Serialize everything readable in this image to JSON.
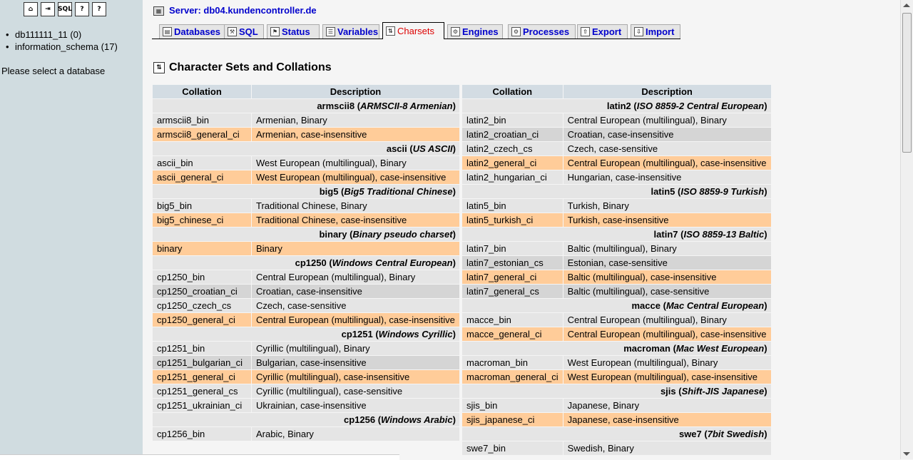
{
  "nav": {
    "icons": [
      {
        "name": "home-icon",
        "glyph": "⌂"
      },
      {
        "name": "exit-icon",
        "glyph": "⇥"
      },
      {
        "name": "sql-query-icon",
        "glyph": "SQL"
      },
      {
        "name": "documentation-icon",
        "glyph": "?"
      },
      {
        "name": "sql-docs-icon",
        "glyph": "?"
      }
    ],
    "databases": [
      "db111111_11 (0)",
      "information_schema (17)"
    ],
    "message": "Please select a database"
  },
  "header": {
    "server_label": "Server: db04.kundencontroller.de"
  },
  "tabs": [
    {
      "label": "Databases",
      "icon": "database-icon"
    },
    {
      "label": "SQL",
      "icon": "sql-icon"
    },
    {
      "label": "Status",
      "icon": "status-icon"
    },
    {
      "label": "Variables",
      "icon": "variables-icon"
    },
    {
      "label": "Charsets",
      "icon": "charsets-icon",
      "active": true
    },
    {
      "label": "Engines",
      "icon": "engines-icon"
    },
    {
      "label": "Processes",
      "icon": "processes-icon"
    },
    {
      "label": "Export",
      "icon": "export-icon"
    },
    {
      "label": "Import",
      "icon": "import-icon"
    }
  ],
  "page_title": "Character Sets and Collations",
  "table_headers": {
    "collation": "Collation",
    "description": "Description"
  },
  "charsets_left": [
    {
      "type": "group",
      "name": "armscii8",
      "desc": "ARMSCII-8 Armenian"
    },
    {
      "type": "row",
      "style": "odd",
      "collation": "armscii8_bin",
      "description": "Armenian, Binary"
    },
    {
      "type": "row",
      "style": "def",
      "collation": "armscii8_general_ci",
      "description": "Armenian, case-insensitive"
    },
    {
      "type": "group",
      "name": "ascii",
      "desc": "US ASCII"
    },
    {
      "type": "row",
      "style": "odd",
      "collation": "ascii_bin",
      "description": "West European (multilingual), Binary"
    },
    {
      "type": "row",
      "style": "def",
      "collation": "ascii_general_ci",
      "description": "West European (multilingual), case-insensitive"
    },
    {
      "type": "group",
      "name": "big5",
      "desc": "Big5 Traditional Chinese"
    },
    {
      "type": "row",
      "style": "odd",
      "collation": "big5_bin",
      "description": "Traditional Chinese, Binary"
    },
    {
      "type": "row",
      "style": "def",
      "collation": "big5_chinese_ci",
      "description": "Traditional Chinese, case-insensitive"
    },
    {
      "type": "group",
      "name": "binary",
      "desc": "Binary pseudo charset"
    },
    {
      "type": "row",
      "style": "def",
      "collation": "binary",
      "description": "Binary"
    },
    {
      "type": "group",
      "name": "cp1250",
      "desc": "Windows Central European"
    },
    {
      "type": "row",
      "style": "odd",
      "collation": "cp1250_bin",
      "description": "Central European (multilingual), Binary"
    },
    {
      "type": "row",
      "style": "alt",
      "collation": "cp1250_croatian_ci",
      "description": "Croatian, case-insensitive"
    },
    {
      "type": "row",
      "style": "odd",
      "collation": "cp1250_czech_cs",
      "description": "Czech, case-sensitive"
    },
    {
      "type": "row",
      "style": "def",
      "collation": "cp1250_general_ci",
      "description": "Central European (multilingual), case-insensitive"
    },
    {
      "type": "group",
      "name": "cp1251",
      "desc": "Windows Cyrillic"
    },
    {
      "type": "row",
      "style": "odd",
      "collation": "cp1251_bin",
      "description": "Cyrillic (multilingual), Binary"
    },
    {
      "type": "row",
      "style": "alt",
      "collation": "cp1251_bulgarian_ci",
      "description": "Bulgarian, case-insensitive"
    },
    {
      "type": "row",
      "style": "def",
      "collation": "cp1251_general_ci",
      "description": "Cyrillic (multilingual), case-insensitive"
    },
    {
      "type": "row",
      "style": "odd",
      "collation": "cp1251_general_cs",
      "description": "Cyrillic (multilingual), case-sensitive"
    },
    {
      "type": "row",
      "style": "odd",
      "collation": "cp1251_ukrainian_ci",
      "description": "Ukrainian, case-insensitive"
    },
    {
      "type": "group",
      "name": "cp1256",
      "desc": "Windows Arabic"
    },
    {
      "type": "row",
      "style": "odd",
      "collation": "cp1256_bin",
      "description": "Arabic, Binary"
    }
  ],
  "charsets_right": [
    {
      "type": "group",
      "name": "latin2",
      "desc": "ISO 8859-2 Central European"
    },
    {
      "type": "row",
      "style": "odd",
      "collation": "latin2_bin",
      "description": "Central European (multilingual), Binary"
    },
    {
      "type": "row",
      "style": "alt",
      "collation": "latin2_croatian_ci",
      "description": "Croatian, case-insensitive"
    },
    {
      "type": "row",
      "style": "odd",
      "collation": "latin2_czech_cs",
      "description": "Czech, case-sensitive"
    },
    {
      "type": "row",
      "style": "def",
      "collation": "latin2_general_ci",
      "description": "Central European (multilingual), case-insensitive"
    },
    {
      "type": "row",
      "style": "odd",
      "collation": "latin2_hungarian_ci",
      "description": "Hungarian, case-insensitive"
    },
    {
      "type": "group",
      "name": "latin5",
      "desc": "ISO 8859-9 Turkish"
    },
    {
      "type": "row",
      "style": "odd",
      "collation": "latin5_bin",
      "description": "Turkish, Binary"
    },
    {
      "type": "row",
      "style": "def",
      "collation": "latin5_turkish_ci",
      "description": "Turkish, case-insensitive"
    },
    {
      "type": "group",
      "name": "latin7",
      "desc": "ISO 8859-13 Baltic"
    },
    {
      "type": "row",
      "style": "odd",
      "collation": "latin7_bin",
      "description": "Baltic (multilingual), Binary"
    },
    {
      "type": "row",
      "style": "alt",
      "collation": "latin7_estonian_cs",
      "description": "Estonian, case-sensitive"
    },
    {
      "type": "row",
      "style": "def",
      "collation": "latin7_general_ci",
      "description": "Baltic (multilingual), case-insensitive"
    },
    {
      "type": "row",
      "style": "alt",
      "collation": "latin7_general_cs",
      "description": "Baltic (multilingual), case-sensitive"
    },
    {
      "type": "group",
      "name": "macce",
      "desc": "Mac Central European"
    },
    {
      "type": "row",
      "style": "odd",
      "collation": "macce_bin",
      "description": "Central European (multilingual), Binary"
    },
    {
      "type": "row",
      "style": "def",
      "collation": "macce_general_ci",
      "description": "Central European (multilingual), case-insensitive"
    },
    {
      "type": "group",
      "name": "macroman",
      "desc": "Mac West European"
    },
    {
      "type": "row",
      "style": "odd",
      "collation": "macroman_bin",
      "description": "West European (multilingual), Binary"
    },
    {
      "type": "row",
      "style": "def",
      "collation": "macroman_general_ci",
      "description": "West European (multilingual), case-insensitive"
    },
    {
      "type": "group",
      "name": "sjis",
      "desc": "Shift-JIS Japanese"
    },
    {
      "type": "row",
      "style": "odd",
      "collation": "sjis_bin",
      "description": "Japanese, Binary"
    },
    {
      "type": "row",
      "style": "def",
      "collation": "sjis_japanese_ci",
      "description": "Japanese, case-insensitive"
    },
    {
      "type": "group",
      "name": "swe7",
      "desc": "7bit Swedish"
    },
    {
      "type": "row",
      "style": "odd",
      "collation": "swe7_bin",
      "description": "Swedish, Binary"
    }
  ],
  "colors": {
    "nav_background": "#d0dce0",
    "header_background": "#d3dce3",
    "default_collation_highlight": "#ffcc99",
    "row_background": "#e5e5e5",
    "link": "#0000cc",
    "active_tab": "#dd0000"
  }
}
